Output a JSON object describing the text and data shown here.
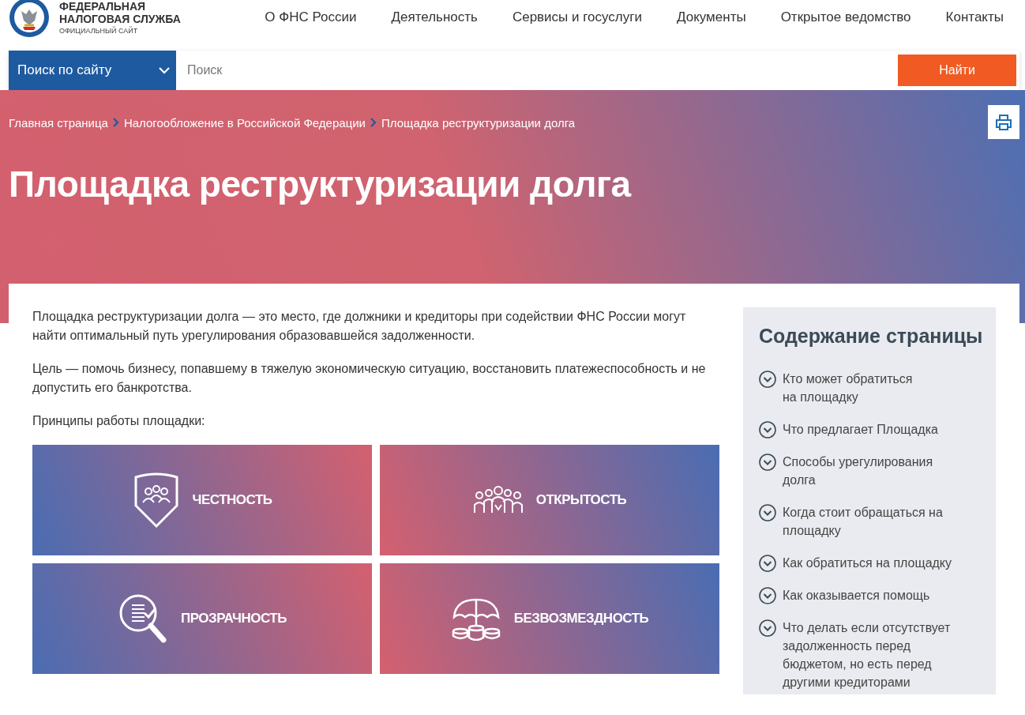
{
  "header": {
    "logo_title": "ФЕДЕРАЛЬНАЯ НАЛОГОВАЯ СЛУЖБА",
    "logo_subtitle": "ОФИЦИАЛЬНЫЙ САЙТ",
    "nav": [
      "О ФНС России",
      "Деятельность",
      "Сервисы и госуслуги",
      "Документы",
      "Открытое ведомство",
      "Контакты"
    ]
  },
  "search": {
    "scope": "Поиск по сайту",
    "placeholder": "Поиск",
    "button": "Найти"
  },
  "breadcrumbs": [
    "Главная страница",
    "Налогообложение в Российской Федерации",
    "Площадка реструктуризации долга"
  ],
  "page_title": "Площадка реструктуризации долга",
  "paragraphs": [
    "Площадка реструктуризации долга — это место, где должники и кредиторы при содействии ФНС России могут найти оптимальный путь урегулирования образовавшейся задолженности.",
    "Цель — помочь бизнесу, попавшему в тяжелую экономическую ситуацию, восстановить платежеспособность и не допустить его банкротства.",
    "Принципы работы площадки:"
  ],
  "principles": [
    {
      "kind": "shield",
      "label": "ЧЕСТНОСТЬ"
    },
    {
      "kind": "team",
      "label": "ОТКРЫТОСТЬ"
    },
    {
      "kind": "magnifier",
      "label": "ПРОЗРАЧНОСТЬ"
    },
    {
      "kind": "umbrella",
      "label": "БЕЗВОЗМЕЗДНОСТЬ"
    }
  ],
  "toc": {
    "title": "Содержание страницы",
    "items": [
      "Кто может обратиться\nна площадку",
      "Что предлагает Площадка",
      "Способы урегулирования долга",
      "Когда стоит обращаться на площадку",
      "Как обратиться на площадку",
      "Как оказывается помощь",
      "Что делать если отсутствует задолженность перед бюджетом, но есть перед другими кредиторами"
    ]
  }
}
